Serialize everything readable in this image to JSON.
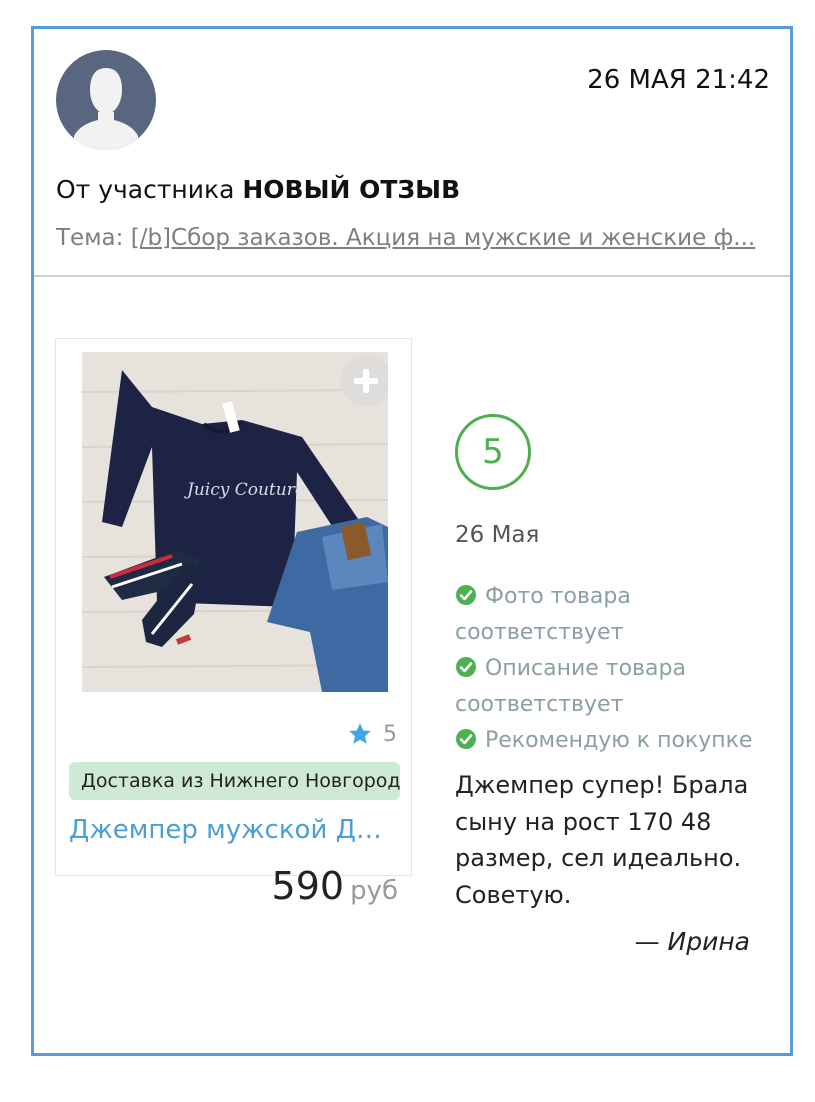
{
  "post": {
    "date": "26 МАЯ 21:42",
    "from_prefix": "От участника",
    "from_name": "НОВЫЙ ОТЗЫВ",
    "topic_label": "Тема:",
    "topic_link": "[/b]Сбор заказов. Акция на мужские и женские ф..."
  },
  "product": {
    "rating_icon": "star-icon",
    "rating": "5",
    "delivery": "Доставка из Нижнего Новгорода",
    "name": "Джемпер мужской ДД-...",
    "price": "590",
    "currency": "руб",
    "image_text": "Juicy Couture"
  },
  "review": {
    "score": "5",
    "date": "26 Мая",
    "checks": [
      {
        "label": "Фото товара соответствует"
      },
      {
        "label": "Описание товара соответствует"
      },
      {
        "label": "Рекомендую к покупке"
      }
    ],
    "text": "Джемпер супер! Брала сыну на рост 170 48 размер, сел идеально. Советую.",
    "author": "— Ирина"
  },
  "colors": {
    "border": "#5b9bd5",
    "link_blue": "#4a9fd6",
    "check_green": "#4caf50",
    "delivery_bg": "#cfead4"
  }
}
